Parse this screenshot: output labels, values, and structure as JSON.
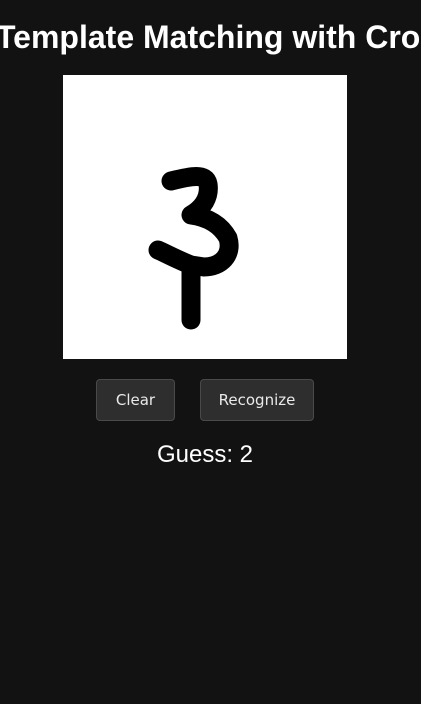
{
  "header": {
    "title": "Template Matching with Cro"
  },
  "canvas": {
    "background": "#ffffff",
    "stroke_color": "#000000"
  },
  "controls": {
    "clear_label": "Clear",
    "recognize_label": "Recognize"
  },
  "result": {
    "prefix": "Guess:",
    "value": "2"
  },
  "colors": {
    "page_background": "#121212",
    "button_background": "#2e2e2e",
    "text": "#ffffff"
  }
}
